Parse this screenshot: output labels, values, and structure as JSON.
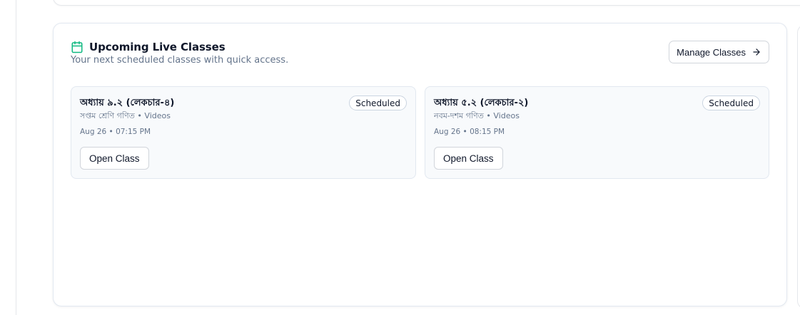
{
  "section": {
    "title": "Upcoming Live Classes",
    "subtitle": "Your next scheduled classes with quick access.",
    "manage_label": "Manage Classes",
    "accent_color": "#10b981"
  },
  "classes": [
    {
      "title": "অধ্যায় ৯.২ (লেকচার-৪)",
      "meta": "সপ্তম শ্রেণি গণিত • Videos",
      "time": "Aug 26 • 07:15 PM",
      "status": "Scheduled",
      "open_label": "Open Class"
    },
    {
      "title": "অধ্যায় ৫.২ (লেকচার-২)",
      "meta": "নবম-দশম গণিত • Videos",
      "time": "Aug 26 • 08:15 PM",
      "status": "Scheduled",
      "open_label": "Open Class"
    }
  ],
  "icons": {
    "header": "calendar-icon",
    "manage": "arrow-right-icon"
  }
}
